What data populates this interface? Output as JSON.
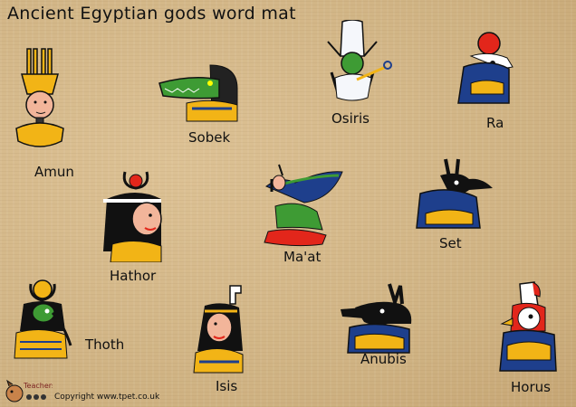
{
  "title": "Ancient Egyptian gods word mat",
  "gods": [
    {
      "name": "Amun"
    },
    {
      "name": "Sobek"
    },
    {
      "name": "Osiris"
    },
    {
      "name": "Ra"
    },
    {
      "name": "Hathor"
    },
    {
      "name": "Ma'at"
    },
    {
      "name": "Set"
    },
    {
      "name": "Thoth"
    },
    {
      "name": "Isis"
    },
    {
      "name": "Anubis"
    },
    {
      "name": "Horus"
    }
  ],
  "footer": {
    "logo_text": "Teachers",
    "copyright": "Copyright www.tpet.co.uk"
  },
  "colors": {
    "background": "#d6b98a",
    "gold": "#f2b416",
    "blue": "#1e3f8c",
    "red": "#e2261b",
    "skin": "#f2b59a",
    "green": "#3e9b34"
  }
}
